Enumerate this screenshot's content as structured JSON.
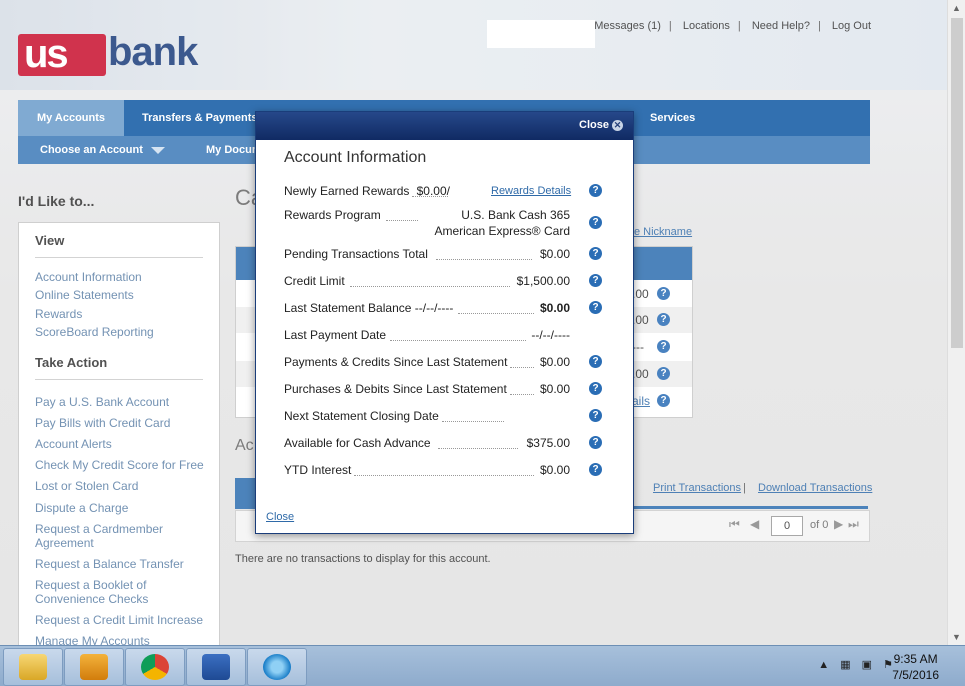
{
  "header": {
    "logo_text_us": "us",
    "logo_text_bank": "bank",
    "links": [
      "Messages (1)",
      "Locations",
      "Need Help?",
      "Log Out"
    ]
  },
  "nav": {
    "primary": [
      "My Accounts",
      "Transfers & Payments",
      "Services"
    ],
    "secondary": [
      "Choose an Account",
      "My Docum"
    ]
  },
  "sidebar": {
    "heading": "I'd Like to...",
    "view_title": "View",
    "view_items": [
      "Account Information",
      "Online Statements",
      "Rewards",
      "ScoreBoard Reporting"
    ],
    "action_title": "Take Action",
    "action_items": [
      "Pay a U.S. Bank Account",
      "Pay Bills with Credit Card",
      "Account Alerts",
      "Check My Credit Score for Free",
      "Lost or Stolen Card",
      "Dispute a Charge",
      "Request a Cardmember Agreement",
      "Request a Balance Transfer",
      "Request a Booklet of Convenience Checks",
      "Request a Credit Limit Increase",
      "Manage My Accounts"
    ]
  },
  "main": {
    "ca_fragment": "Ca",
    "nickname_link": "e Nickname",
    "panel_values": [
      ".00",
      ".00",
      "---",
      ".00",
      "ails"
    ],
    "ac_fragment": "Ac",
    "print_link": "Print Transactions",
    "download_link": "Download Transactions",
    "pager_value": "0",
    "pager_of": "of 0",
    "no_tx": "There are no transactions to display for this account."
  },
  "modal": {
    "close_label": "Close",
    "title": "Account Information",
    "rows": [
      {
        "label": "Newly Earned Rewards",
        "value": "$0.00/",
        "link": "Rewards Details"
      },
      {
        "label": "Rewards Program",
        "value": "U.S. Bank Cash 365",
        "value2": "American Express® Card"
      },
      {
        "label": "Pending Transactions Total",
        "value": "$0.00"
      },
      {
        "label": "Credit Limit",
        "value": "$1,500.00"
      },
      {
        "label": "Last Statement Balance --/--/----",
        "value": "$0.00"
      },
      {
        "label": "Last Payment Date",
        "value": "--/--/----"
      },
      {
        "label": "Payments & Credits Since Last Statement",
        "value": "$0.00"
      },
      {
        "label": "Purchases & Debits Since Last Statement",
        "value": "$0.00"
      },
      {
        "label": "Next Statement Closing Date",
        "value": ""
      },
      {
        "label": "Available for Cash Advance",
        "value": "$375.00"
      },
      {
        "label": "YTD Interest",
        "value": "$0.00"
      }
    ],
    "footer_close": "Close",
    "help_glyph": "?"
  },
  "taskbar": {
    "time": "9:35 AM",
    "date": "7/5/2016",
    "apps": [
      "file-explorer",
      "outlook",
      "chrome",
      "word",
      "internet-explorer"
    ]
  },
  "colors": {
    "brand_blue": "#1b3c7b",
    "brand_red": "#c8102e",
    "nav_blue": "#0f58a3"
  }
}
